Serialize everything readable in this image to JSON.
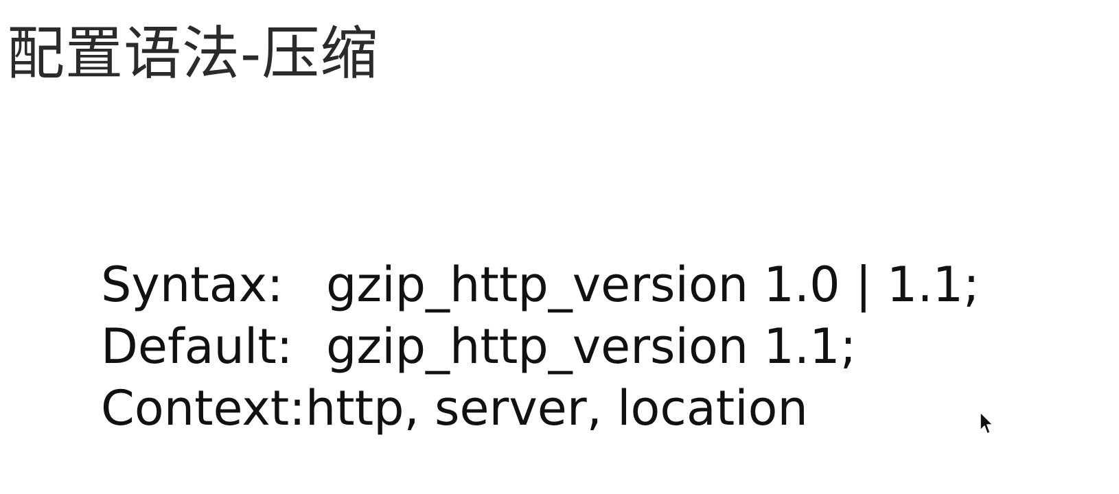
{
  "title": "配置语法-压缩",
  "directive": {
    "syntax_label": "Syntax:",
    "syntax_value": "gzip_http_version 1.0 | 1.1;",
    "default_label": "Default:",
    "default_value": "gzip_http_version 1.1;",
    "context_label": "Context:",
    "context_value": "http, server, location"
  },
  "icons": {
    "cursor": "mouse-pointer-icon"
  }
}
